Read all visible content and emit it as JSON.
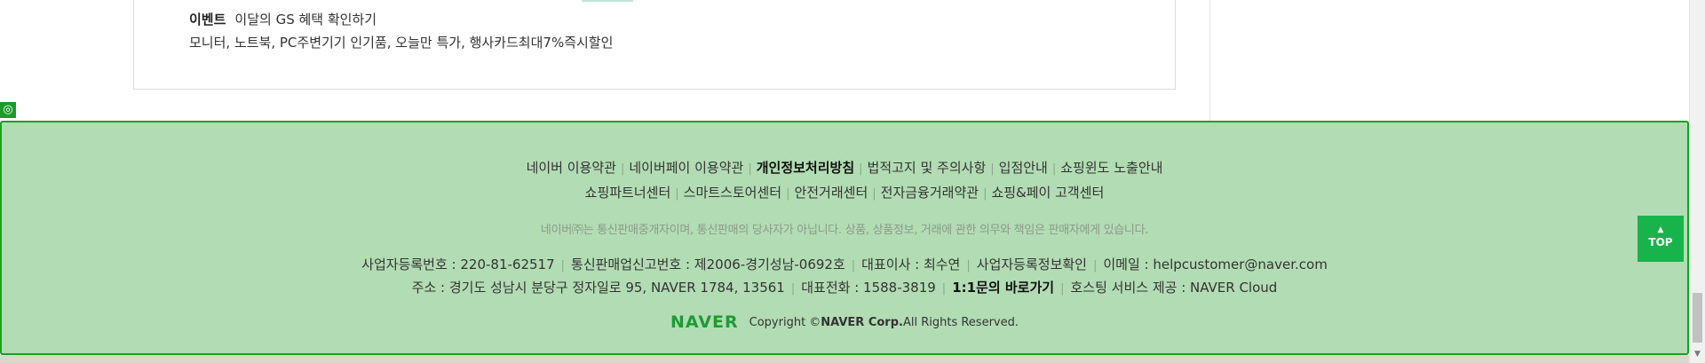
{
  "event": {
    "tag": "이벤트",
    "text": "이달의 GS 혜택 확인하기",
    "promo": "모니터, 노트북, PC주변기기 인기품, 오늘만 특가, 행사카드최대7%즉시할인"
  },
  "inspector": {
    "icon": "◎"
  },
  "footer": {
    "links_row1": [
      "네이버 이용약관",
      "네이버페이 이용약관",
      "개인정보처리방침",
      "법적고지 및 주의사항",
      "입점안내",
      "쇼핑윈도 노출안내"
    ],
    "links_row2": [
      "쇼핑파트너센터",
      "스마트스토어센터",
      "안전거래센터",
      "전자금융거래약관",
      "쇼핑&페이 고객센터"
    ],
    "notice": "네이버㈜는 통신판매중개자이며, 통신판매의 당사자가 아닙니다. 상품, 상품정보, 거래에 관한 의무와 책임은 판매자에게 있습니다.",
    "info_row1": {
      "biz_reg": "사업자등록번호 : 220-81-62517",
      "mail_order": "통신판매업신고번호 : 제2006-경기성남-0692호",
      "ceo": "대표이사 : 최수연",
      "biz_check": "사업자등록정보확인",
      "email": "이메일 : helpcustomer@naver.com"
    },
    "info_row2": {
      "address": "주소 : 경기도 성남시 분당구 정자일로 95, NAVER 1784, 13561",
      "phone": "대표전화 : 1588-3819",
      "inquiry": "1:1문의 바로가기",
      "hosting": "호스팅 서비스 제공 : NAVER Cloud"
    },
    "copyright": {
      "logo": "NAVER",
      "prefix": "Copyright ©",
      "corp": "NAVER Corp.",
      "suffix": "All Rights Reserved."
    }
  },
  "top_button": {
    "arrow": "▲",
    "label": "TOP"
  },
  "scrollbar": {
    "down_arrow": "▼"
  }
}
